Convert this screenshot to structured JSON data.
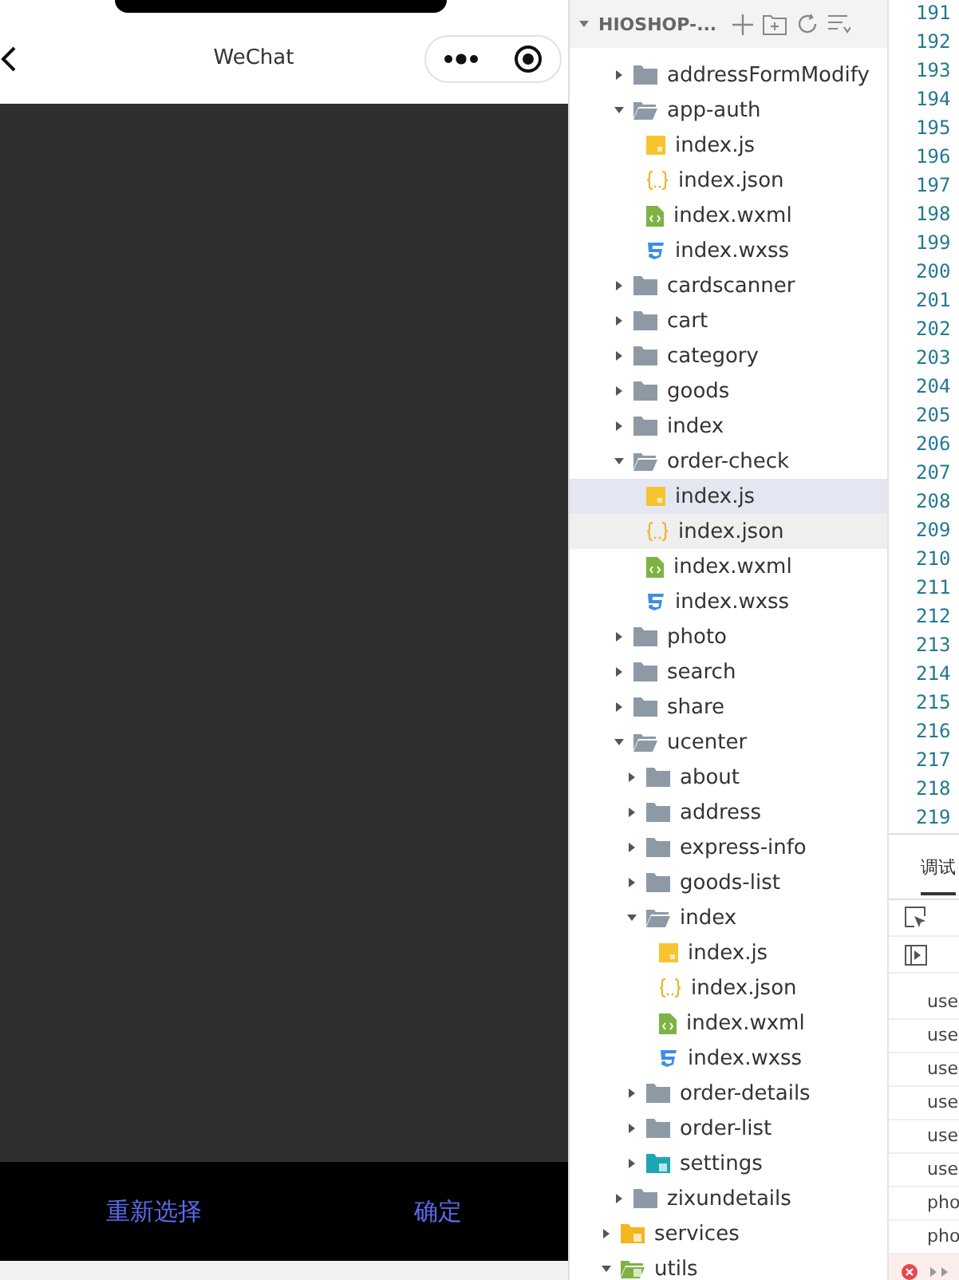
{
  "simulator": {
    "nav_title": "WeChat",
    "bottom_buttons": [
      {
        "label": "重新选择"
      },
      {
        "label": "确定"
      }
    ]
  },
  "explorer": {
    "project": "HIOSHOP-...",
    "nested_items": [
      {
        "name": "addressFormModify",
        "kind": "folder",
        "expanded": false,
        "selected": false
      },
      {
        "name": "app-auth",
        "kind": "folder",
        "expanded": true,
        "selected": false,
        "children": [
          {
            "name": "index.js",
            "kind": "js",
            "selected": false
          },
          {
            "name": "index.json",
            "kind": "json",
            "selected": false
          },
          {
            "name": "index.wxml",
            "kind": "wxml",
            "selected": false
          },
          {
            "name": "index.wxss",
            "kind": "wxss",
            "selected": false
          }
        ]
      },
      {
        "name": "cardscanner",
        "kind": "folder",
        "expanded": false,
        "selected": false
      },
      {
        "name": "cart",
        "kind": "folder",
        "expanded": false,
        "selected": false
      },
      {
        "name": "category",
        "kind": "folder",
        "expanded": false,
        "selected": false
      },
      {
        "name": "goods",
        "kind": "folder",
        "expanded": false,
        "selected": false
      },
      {
        "name": "index",
        "kind": "folder",
        "expanded": false,
        "selected": false
      },
      {
        "name": "order-check",
        "kind": "folder",
        "expanded": true,
        "selected": false,
        "children": [
          {
            "name": "index.js",
            "kind": "js",
            "selected": true
          },
          {
            "name": "index.json",
            "kind": "json",
            "selected": false,
            "hovered": true
          },
          {
            "name": "index.wxml",
            "kind": "wxml",
            "selected": false
          },
          {
            "name": "index.wxss",
            "kind": "wxss",
            "selected": false
          }
        ]
      },
      {
        "name": "photo",
        "kind": "folder",
        "expanded": false,
        "selected": false
      },
      {
        "name": "search",
        "kind": "folder",
        "expanded": false,
        "selected": false
      },
      {
        "name": "share",
        "kind": "folder",
        "expanded": false,
        "selected": false
      },
      {
        "name": "ucenter",
        "kind": "folder",
        "expanded": true,
        "selected": false,
        "children": [
          {
            "name": "about",
            "kind": "folder",
            "expanded": false,
            "selected": false
          },
          {
            "name": "address",
            "kind": "folder",
            "expanded": false,
            "selected": false
          },
          {
            "name": "express-info",
            "kind": "folder",
            "expanded": false,
            "selected": false
          },
          {
            "name": "goods-list",
            "kind": "folder",
            "expanded": false,
            "selected": false
          },
          {
            "name": "index",
            "kind": "folder",
            "expanded": true,
            "selected": false,
            "children": [
              {
                "name": "index.js",
                "kind": "js",
                "selected": false
              },
              {
                "name": "index.json",
                "kind": "json",
                "selected": false
              },
              {
                "name": "index.wxml",
                "kind": "wxml",
                "selected": false
              },
              {
                "name": "index.wxss",
                "kind": "wxss",
                "selected": false
              }
            ]
          },
          {
            "name": "order-details",
            "kind": "folder",
            "expanded": false,
            "selected": false
          },
          {
            "name": "order-list",
            "kind": "folder",
            "expanded": false,
            "selected": false
          },
          {
            "name": "settings",
            "kind": "settings-folder",
            "expanded": false,
            "selected": false
          }
        ]
      },
      {
        "name": "zixundetails",
        "kind": "folder",
        "expanded": false,
        "selected": false
      }
    ],
    "items": [
      {
        "name": "services",
        "kind": "service-folder",
        "expanded": false,
        "selected": false
      },
      {
        "name": "utils",
        "kind": "util-folder",
        "expanded": true,
        "selected": false
      }
    ]
  },
  "editor": {
    "line_numbers": [
      "191",
      "192",
      "193",
      "194",
      "195",
      "196",
      "197",
      "198",
      "199",
      "200",
      "201",
      "202",
      "203",
      "204",
      "205",
      "206",
      "207",
      "208",
      "209",
      "210",
      "211",
      "212",
      "213",
      "214",
      "215",
      "216",
      "217",
      "218",
      "219"
    ]
  },
  "console": {
    "tab": "调试",
    "log_rows": [
      "use",
      "use",
      "use",
      "use",
      "use",
      "use",
      "pho",
      "pho"
    ]
  }
}
